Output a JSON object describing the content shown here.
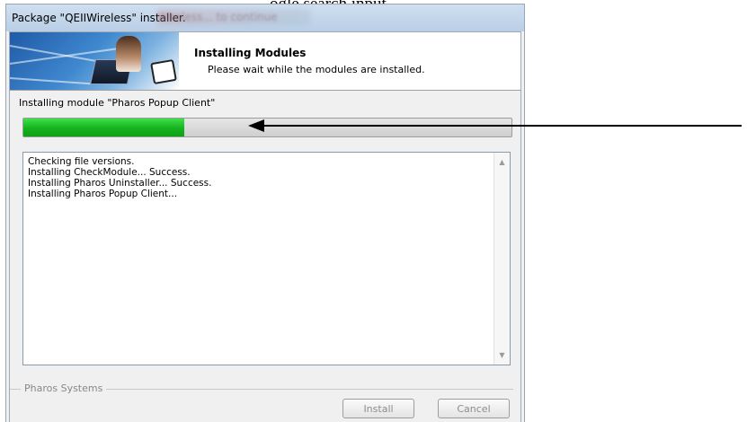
{
  "document": {
    "top_text": "ogle search input"
  },
  "window": {
    "title": "Package \"QEIIWireless\" installer.",
    "title_obscured": "Wireless... to continue"
  },
  "header": {
    "title": "Installing Modules",
    "subtitle": "Please wait while the modules are installed."
  },
  "status": {
    "label": "Installing module \"Pharos Popup Client\"",
    "progress_percent": 33
  },
  "log": {
    "lines": [
      "Checking file versions.",
      "Installing CheckModule... Success.",
      "Installing Pharos Uninstaller... Success.",
      "Installing Pharos Popup Client..."
    ]
  },
  "footer": {
    "group_label": "Pharos Systems",
    "install_label": "Install",
    "cancel_label": "Cancel"
  },
  "icons": {
    "scroll_up": "scroll-up-arrow-icon",
    "scroll_down": "scroll-down-arrow-icon",
    "annotation": "annotation-arrow-icon"
  },
  "colors": {
    "progress": "#15b21f",
    "titlebar": "#b9cfe6"
  }
}
